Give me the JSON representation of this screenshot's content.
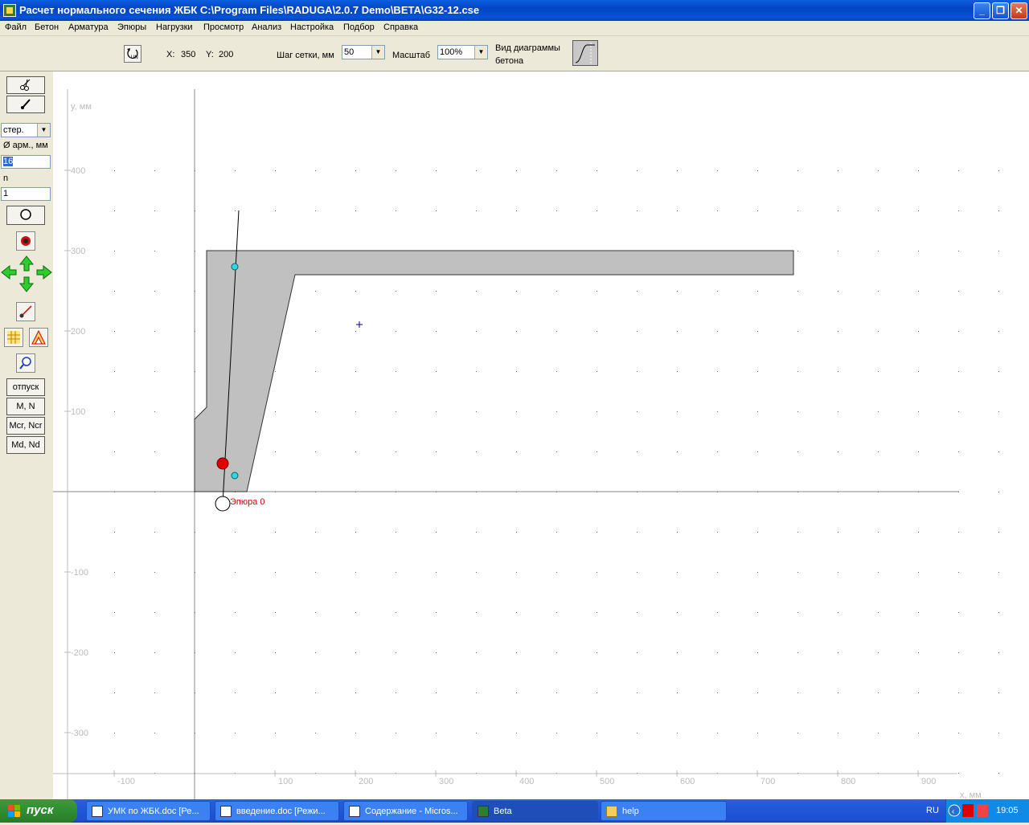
{
  "window": {
    "title": "Расчет нормального сечения ЖБК   C:\\Program Files\\RADUGA\\2.0.7 Demo\\BETA\\G32-12.cse",
    "minimize": "_",
    "restore": "❐",
    "close": "✕"
  },
  "menu": [
    "Файл",
    "Бетон",
    "Арматура",
    "Эпюры",
    "Нагрузки",
    "Просмотр",
    "Анализ",
    "Настройка",
    "Подбор",
    "Справка"
  ],
  "toolbar": {
    "reset_icon": "undo-zoom-icon",
    "x_label": "X:",
    "x_value": "350",
    "y_label": "Y:",
    "y_value": "200",
    "grid_label": "Шаг сетки, мм",
    "grid_value": "50",
    "scale_label": "Масштаб",
    "scale_value": "100%",
    "diagram_label_1": "Вид диаграммы",
    "diagram_label_2": "бетона"
  },
  "left_panel": {
    "steel_type": "стер.",
    "diameter_label": "Ø арм., мм",
    "diameter_value": "16",
    "n_label": "n",
    "n_value": "1",
    "btn_release": "отпуск",
    "btn_mn": "M, N",
    "btn_mcr": "Mcr, Ncr",
    "btn_md": "Md, Nd"
  },
  "canvas": {
    "y_axis_label": "y, мм",
    "x_axis_label": "x, мм",
    "y_ticks": [
      "400",
      "300",
      "200",
      "100",
      "-100",
      "-200",
      "-300"
    ],
    "x_ticks": [
      "-100",
      "100",
      "200",
      "300",
      "400",
      "500",
      "600",
      "700",
      "800",
      "900"
    ],
    "epure_label": "Эпюра 0"
  },
  "taskbar": {
    "start": "пуск",
    "tasks": [
      {
        "label": "УМК по ЖБК.doc [Ре..."
      },
      {
        "label": "введение.doc [Режи..."
      },
      {
        "label": "Содержание - Micros..."
      },
      {
        "label": "Beta"
      },
      {
        "label": "help"
      }
    ],
    "lang": "RU",
    "time": "19:05"
  }
}
